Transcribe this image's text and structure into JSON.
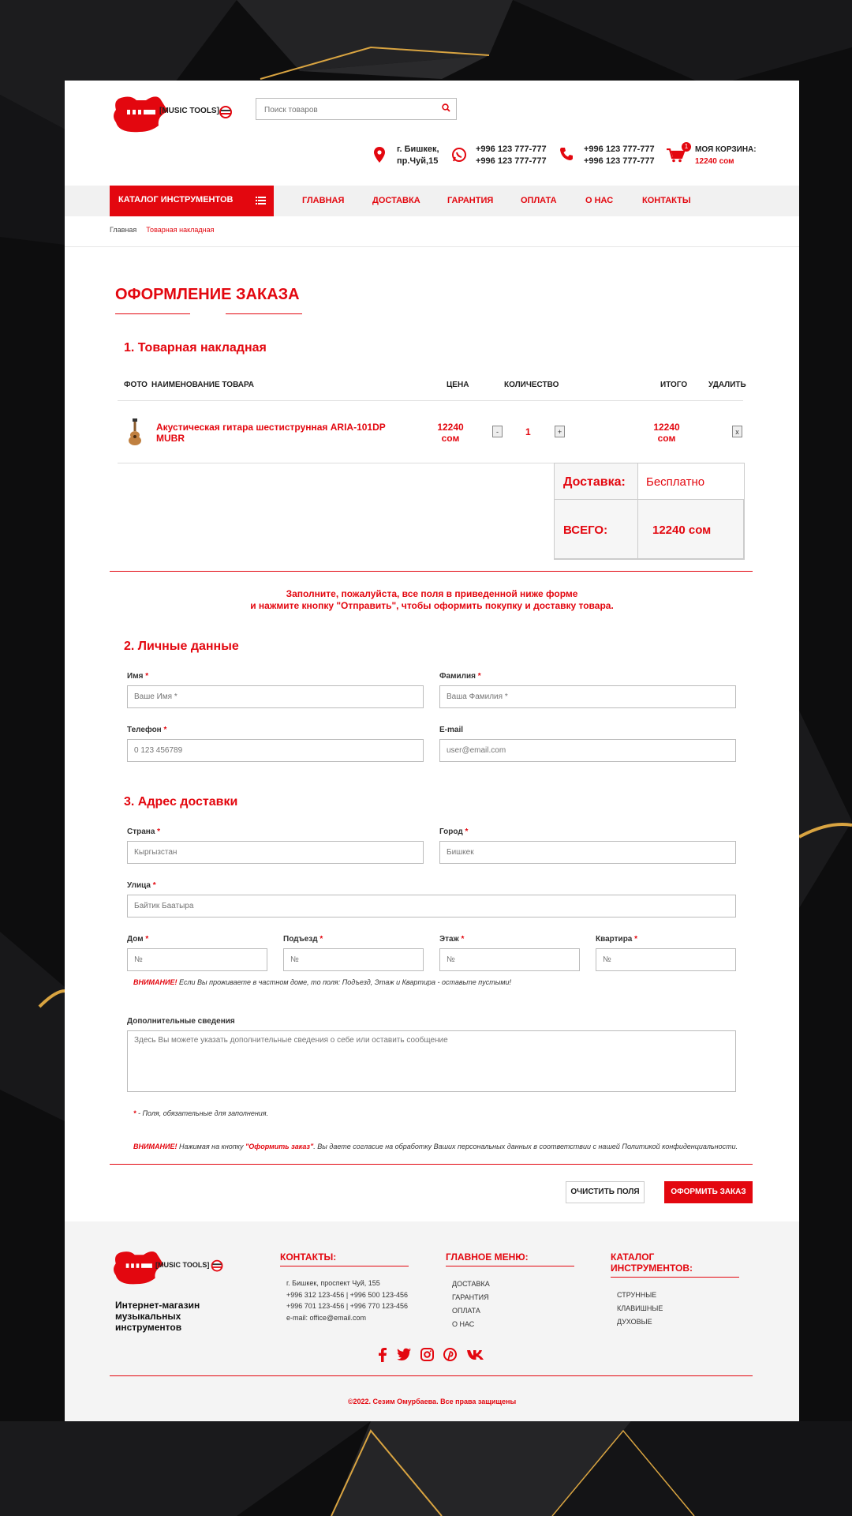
{
  "header": {
    "logo_text": "[MUSIC TOOLS]",
    "search_placeholder": "Поиск товаров",
    "address_line1": "г. Бишкек,",
    "address_line2": "пр.Чуй,15",
    "whatsapp_phone1": "+996 123 777-777",
    "whatsapp_phone2": "+996 123 777-777",
    "phone1": "+996 123 777-777",
    "phone2": "+996 123 777-777",
    "cart_count": "1",
    "cart_label": "МОЯ КОРЗИНА:",
    "cart_total": "12240 сом"
  },
  "nav": {
    "catalog_label": "КАТАЛОГ ИНСТРУМЕНТОВ",
    "items": [
      "ГЛАВНАЯ",
      "ДОСТАВКА",
      "ГАРАНТИЯ",
      "ОПЛАТА",
      "О НАС",
      "КОНТАКТЫ"
    ]
  },
  "breadcrumb": {
    "home": "Главная",
    "current": "Товарная накладная"
  },
  "order": {
    "title": "ОФОРМЛЕНИЕ ЗАКАЗА",
    "section1_title": "1. Товарная накладная",
    "columns": {
      "photo": "ФОТО",
      "name": "НАИМЕНОВАНИЕ ТОВАРА",
      "price": "ЦЕНА",
      "qty": "КОЛИЧЕСТВО",
      "total": "ИТОГО",
      "delete": "УДАЛИТЬ"
    },
    "item": {
      "name": "Акустическая гитара шестиструнная ARIA-101DP MUBR",
      "price_value": "12240",
      "price_unit": "сом",
      "qty": "1",
      "minus": "-",
      "plus": "+",
      "total_value": "12240",
      "total_unit": "сом",
      "remove": "x"
    },
    "delivery_label": "Доставка:",
    "delivery_value": "Бесплатно",
    "total_label": "ВСЕГО:",
    "total_value": "12240 сом",
    "notice_line1": "Заполните, пожалуйста, все поля в приведенной ниже форме",
    "notice_line2": "и нажмите кнопку \"Отправить\", чтобы оформить покупку и доставку товара."
  },
  "personal": {
    "title": "2. Личные данные",
    "first_name_label": "Имя",
    "first_name_placeholder": "Ваше Имя *",
    "last_name_label": "Фамилия",
    "last_name_placeholder": "Ваша Фамилия *",
    "phone_label": "Телефон",
    "phone_placeholder": "0 123 456789",
    "email_label": "E-mail",
    "email_placeholder": "user@email.com",
    "star": "*"
  },
  "address": {
    "title": "3. Адрес доставки",
    "country_label": "Страна",
    "country_placeholder": "Кыргызстан",
    "city_label": "Город",
    "city_placeholder": "Бишкек",
    "street_label": "Улица",
    "street_placeholder": "Байтик Баатыра",
    "house_label": "Дом",
    "entrance_label": "Подъезд",
    "floor_label": "Этаж",
    "apartment_label": "Квартира",
    "number_placeholder": "№",
    "warning_bold": "ВНИМАНИЕ!",
    "warning_text": " Если Вы проживаете в частном доме, то поля: Подъезд, Этаж и Квартира - оставьте пустыми!",
    "extra_label": "Дополнительные сведения",
    "extra_placeholder": "Здесь Вы можете указать дополнительные сведения о себе или оставить сообщение",
    "required_star": "*",
    "required_note": " - Поля, обязательные для заполнения.",
    "consent_bold": "ВНИМАНИЕ!",
    "consent_text1": " Нажимая на кнопку ",
    "consent_button": "\"Оформить заказ\"",
    "consent_text2": ". Вы даете согласие на обработку Ваших персональных данных в соответствии с нашей Политикой конфиденциальности.",
    "clear_button": "ОЧИСТИТЬ ПОЛЯ",
    "submit_button": "ОФОРМИТЬ ЗАКАЗ"
  },
  "footer": {
    "logo_text": "[MUSIC TOOLS]",
    "tagline_line1": "Интернет-магазин",
    "tagline_line2": "музыкальных",
    "tagline_line3": "инструментов",
    "contacts_title": "КОНТАКТЫ:",
    "contacts": [
      "г. Бишкек, проспект Чуй, 155",
      "+996 312 123-456 | +996 500 123-456",
      "+996 701 123-456 | +996 770 123-456",
      "e-mail: office@email.com"
    ],
    "menu_title": "ГЛАВНОЕ МЕНЮ:",
    "menu": [
      "ДОСТАВКА",
      "ГАРАНТИЯ",
      "ОПЛАТА",
      "О НАС"
    ],
    "catalog_title_line1": "КАТАЛОГ",
    "catalog_title_line2": "ИНСТРУМЕНТОВ:",
    "catalog": [
      "СТРУННЫЕ",
      "КЛАВИШНЫЕ",
      "ДУХОВЫЕ"
    ],
    "social": [
      "facebook-icon",
      "twitter-icon",
      "instagram-icon",
      "pinterest-icon",
      "vk-icon"
    ],
    "copyright": "©2022. Сезим Омурбаева. Все права защищены"
  },
  "colors": {
    "accent": "#e3070f",
    "background": "#0c0c0d",
    "gold": "#d9a441"
  }
}
